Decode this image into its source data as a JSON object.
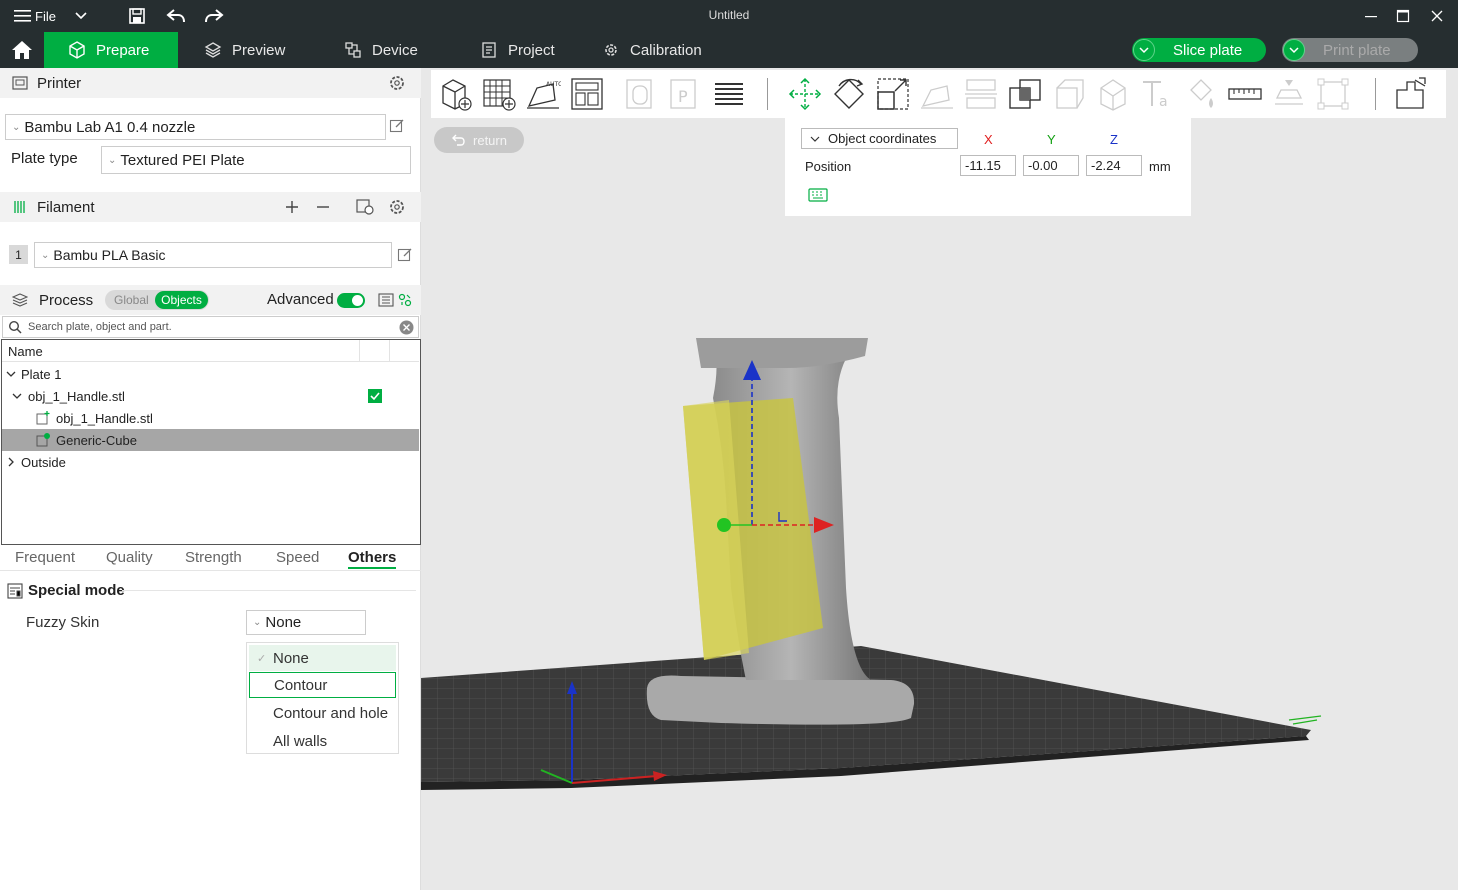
{
  "titlebar": {
    "menu_label": "File",
    "title": "Untitled"
  },
  "nav": {
    "tabs": [
      {
        "label": "Prepare"
      },
      {
        "label": "Preview"
      },
      {
        "label": "Device"
      },
      {
        "label": "Project"
      },
      {
        "label": "Calibration"
      }
    ],
    "slice_label": "Slice plate",
    "print_label": "Print plate"
  },
  "printer": {
    "header": "Printer",
    "selected": "Bambu Lab A1 0.4 nozzle",
    "plate_type_label": "Plate type",
    "plate_type_value": "Textured PEI Plate"
  },
  "filament": {
    "header": "Filament",
    "slot_number": "1",
    "selected": "Bambu PLA Basic"
  },
  "process": {
    "header": "Process",
    "toggle_global": "Global",
    "toggle_objects": "Objects",
    "advanced_label": "Advanced",
    "search_placeholder": "Search plate, object and part."
  },
  "tree": {
    "column_name": "Name",
    "rows": [
      {
        "label": "Plate 1"
      },
      {
        "label": "obj_1_Handle.stl"
      },
      {
        "label": "obj_1_Handle.stl"
      },
      {
        "label": "Generic-Cube"
      },
      {
        "label": "Outside"
      }
    ]
  },
  "settings_tabs": [
    "Frequent",
    "Quality",
    "Strength",
    "Speed",
    "Others"
  ],
  "special_mode": {
    "header": "Special mode",
    "fuzzy_label": "Fuzzy Skin",
    "fuzzy_value": "None",
    "options": [
      "None",
      "Contour",
      "Contour and hole",
      "All walls"
    ]
  },
  "viewport": {
    "return_label": "return",
    "coord_mode": "Object coordinates",
    "axis_x": "X",
    "axis_y": "Y",
    "axis_z": "Z",
    "position_label": "Position",
    "pos_x": "-11.15",
    "pos_y": "-0.00",
    "pos_z": "-2.24",
    "unit": "mm"
  },
  "colors": {
    "accent": "#00ae42",
    "titlebar": "#262e30",
    "viewport_bg": "#e8e8e8",
    "selection_row": "#a6a6a6"
  }
}
